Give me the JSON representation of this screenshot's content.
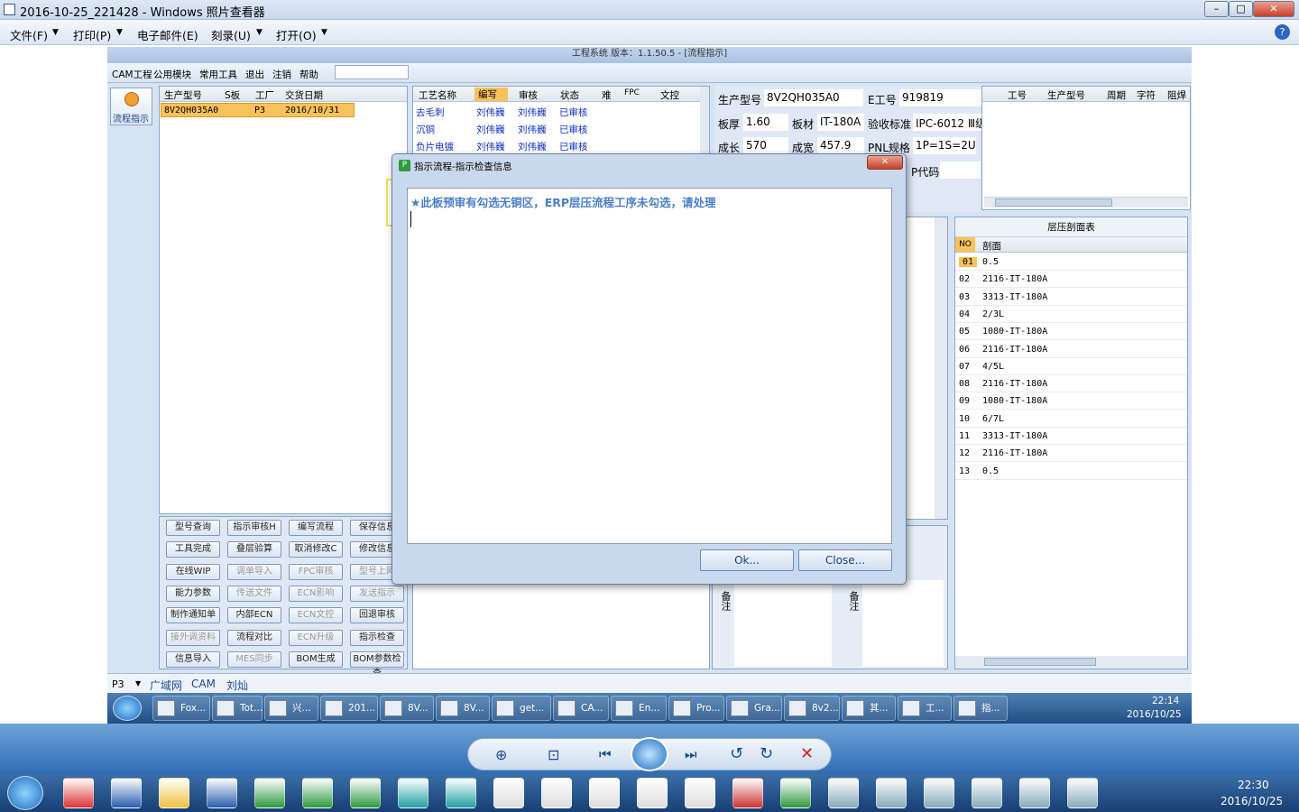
{
  "viewer": {
    "title": "2016-10-25_221428 - Windows 照片查看器",
    "menu": [
      "文件(F)",
      "打印(P)",
      "电子邮件(E)",
      "刻录(U)",
      "打开(O)"
    ]
  },
  "app": {
    "title": "工程系统   版本：1.1.50.5 - [流程指示]",
    "menu": [
      "CAM工程",
      "公用模块",
      "常用工具",
      "退出",
      "注销",
      "帮助"
    ],
    "side_button": "流程指示",
    "order_table": {
      "headers": [
        "生产型号",
        "S板",
        "工厂",
        "交货日期"
      ],
      "row": [
        "8V2QH035A0",
        "",
        "P3",
        "2016/10/31"
      ]
    },
    "process_table": {
      "headers": [
        "工艺名称",
        "编写",
        "审核",
        "状态",
        "难",
        "FPC",
        "文控"
      ],
      "rows": [
        [
          "去毛刺",
          "刘伟巍",
          "刘伟巍",
          "已审核"
        ],
        [
          "沉铜",
          "刘伟巍",
          "刘伟巍",
          "已审核"
        ],
        [
          "负片电镀",
          "刘伟巍",
          "刘伟巍",
          "已审核"
        ]
      ]
    },
    "info": {
      "model_label": "生产型号",
      "model": "8V2QH035A0",
      "e_label": "E工号",
      "e_value": "919819",
      "thick_label": "板厚",
      "thick": "1.60",
      "material_label": "板材",
      "material": "IT-180A",
      "accept_label": "验收标准",
      "accept": "IPC-6012 Ⅲ级",
      "len_label": "成长",
      "len": "570",
      "wid_label": "成宽",
      "wid": "457.9",
      "pnl_label": "PNL规格",
      "pnl": "1P=1S=2U",
      "code_label": "P代码"
    },
    "right_table_headers": [
      "工号",
      "生产型号",
      "周期",
      "字符",
      "阻焊"
    ],
    "stackup": {
      "title": "层压剖面表",
      "headers": [
        "NO",
        "剖面"
      ],
      "rows": [
        [
          "01",
          "0.5"
        ],
        [
          "02",
          "2116-IT-180A"
        ],
        [
          "03",
          "3313-IT-180A"
        ],
        [
          "04",
          "2/3L"
        ],
        [
          "05",
          "1080-IT-180A"
        ],
        [
          "06",
          "2116-IT-180A"
        ],
        [
          "07",
          "4/5L"
        ],
        [
          "08",
          "2116-IT-180A"
        ],
        [
          "09",
          "1080-IT-180A"
        ],
        [
          "10",
          "6/7L"
        ],
        [
          "11",
          "3313-IT-180A"
        ],
        [
          "12",
          "2116-IT-180A"
        ],
        [
          "13",
          "0.5"
        ]
      ]
    },
    "buttons": [
      [
        "型号查询",
        "指示审核H",
        "编写流程",
        "保存信息"
      ],
      [
        "工具完成",
        "叠层验算",
        "取消修改C",
        "修改信息"
      ],
      [
        "在线WIP",
        "调单导入",
        "FPC审核",
        "型号上网"
      ],
      [
        "能力参数",
        "传送文件",
        "ECN影响",
        "发送指示"
      ],
      [
        "制作通知单",
        "内部ECN",
        "ECN文控",
        "回退审核"
      ],
      [
        "接外调资料",
        "流程对比",
        "ECN升级",
        "指示检查"
      ],
      [
        "信息导入",
        "MES同步",
        "BOM生成",
        "BOM参数检查"
      ]
    ],
    "note_label": "备注",
    "status": [
      "P3",
      "广域网",
      "CAM",
      "刘灿"
    ]
  },
  "dialog": {
    "title": "指示流程-指示检查信息",
    "message": "★此板预审有勾选无铜区，ERP层压流程工序未勾选，请处理",
    "ok": "Ok...",
    "close": "Close..."
  },
  "taskbar1": {
    "items": [
      "Fox...",
      "Tot...",
      "兴...",
      "201...",
      "8V...",
      "8V...",
      "get...",
      "CA...",
      "En...",
      "Pro...",
      "Gra...",
      "8v2...",
      "其...",
      "工...",
      "指..."
    ],
    "time": "22:14",
    "date": "2016/10/25"
  },
  "taskbar2": {
    "time": "22:30",
    "date": "2016/10/25"
  },
  "colors": {
    "accent": "#f0e050",
    "selected_row": "#f7c25a"
  }
}
